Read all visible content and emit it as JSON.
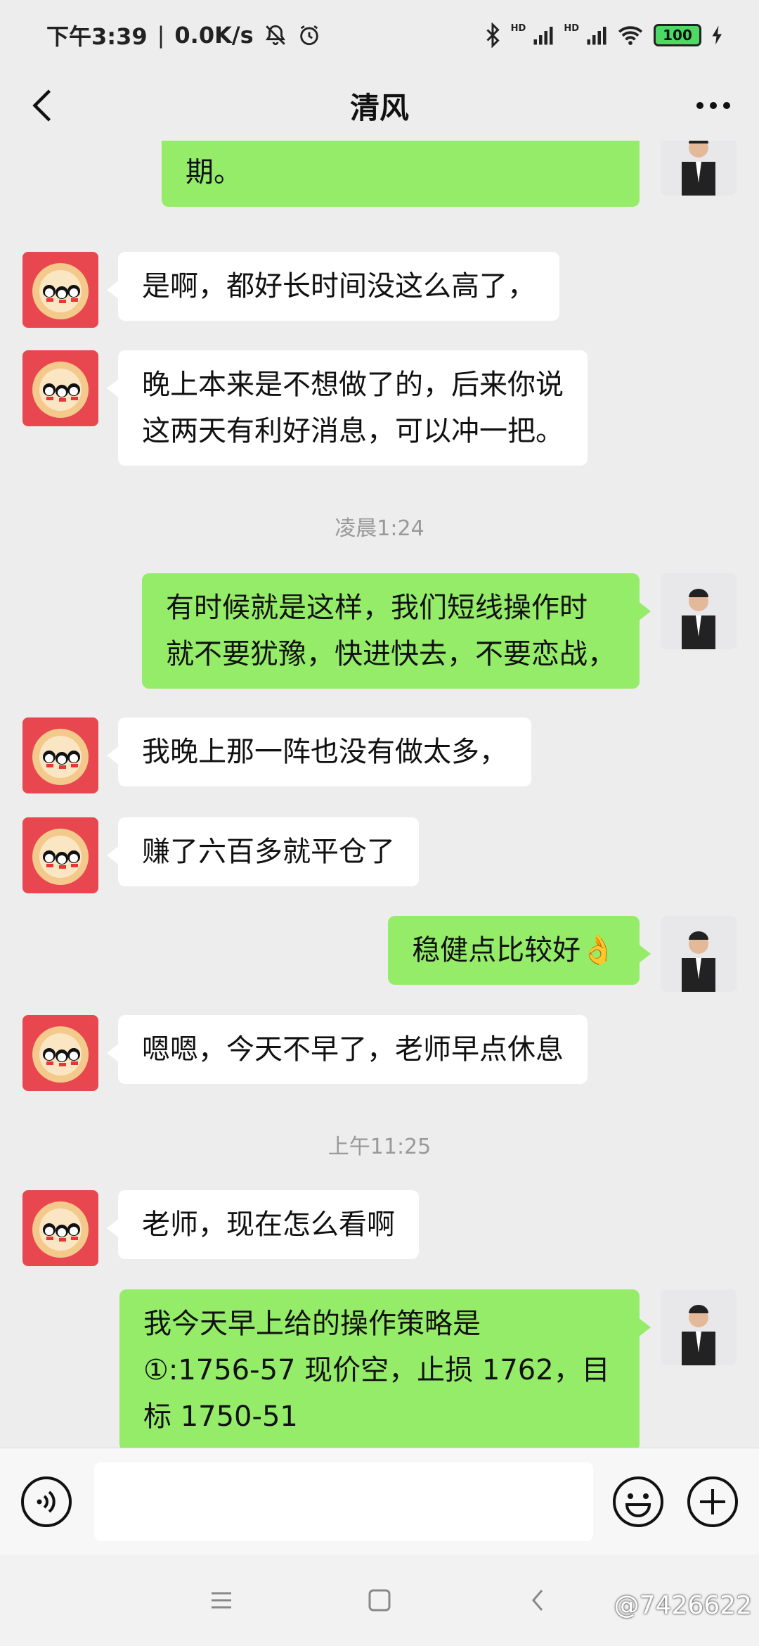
{
  "status_bar": {
    "time": "下午3:39",
    "net_speed": "0.0K/s",
    "hd1": "HD",
    "hd2": "HD",
    "battery": "100"
  },
  "header": {
    "title": "清风"
  },
  "messages": [
    {
      "side": "out",
      "text": "今天黄金上涨超出了很多人的预\n期。"
    },
    {
      "side": "in",
      "text": "是啊，都好长时间没这么高了，"
    },
    {
      "side": "in",
      "text": "晚上本来是不想做了的，后来你说\n这两天有利好消息，可以冲一把。"
    },
    {
      "type": "time",
      "text": "凌晨1:24"
    },
    {
      "side": "out",
      "text": "有时候就是这样，我们短线操作时\n就不要犹豫，快进快去，不要恋战，"
    },
    {
      "side": "in",
      "text": "我晚上那一阵也没有做太多，"
    },
    {
      "side": "in",
      "text": "赚了六百多就平仓了"
    },
    {
      "side": "out",
      "text": "稳健点比较好",
      "emoji": "👌"
    },
    {
      "side": "in",
      "text": "嗯嗯，今天不早了，老师早点休息"
    },
    {
      "type": "time",
      "text": "上午11:25"
    },
    {
      "side": "in",
      "text": "老师，现在怎么看啊"
    },
    {
      "side": "out",
      "text": "我今天早上给的操作策略是\n①:1756-57 现价空，止损 1762，目\n标 1750-51"
    }
  ],
  "watermark": "@7426622",
  "colors": {
    "background": "#ededed",
    "outgoing_bubble": "#95ec69",
    "incoming_bubble": "#ffffff",
    "timestamp_text": "#999999"
  },
  "icons": {
    "back": "chevron-left-icon",
    "more": "more-dots-icon",
    "voice": "voice-icon",
    "emoji": "smiley-icon",
    "plus": "plus-circle-icon"
  }
}
